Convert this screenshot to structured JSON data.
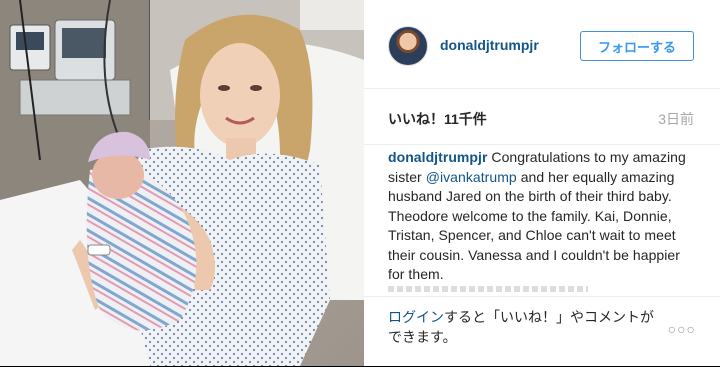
{
  "post": {
    "username": "donaldjtrumpjr",
    "follow_label": "フォローする",
    "likes": "いいね！11千件",
    "time_ago": "3日前",
    "caption_user": "donaldjtrumpjr",
    "caption_pre": " Congratulations to my amazing sister ",
    "caption_mention": "@ivankatrump",
    "caption_post": " and her equally amazing husband Jared on the birth of their third baby. Theodore welcome to the family. Kai, Donnie, Tristan, Spencer, and Chloe can't wait to meet their cousin. Vanessa and I couldn't be happier for them.",
    "login_link": "ログイン",
    "login_rest": "すると「いいね！」やコメントができます。",
    "more_label": "○○○"
  },
  "icons": {
    "avatar": "profile-avatar",
    "more": "more-options-icon"
  }
}
